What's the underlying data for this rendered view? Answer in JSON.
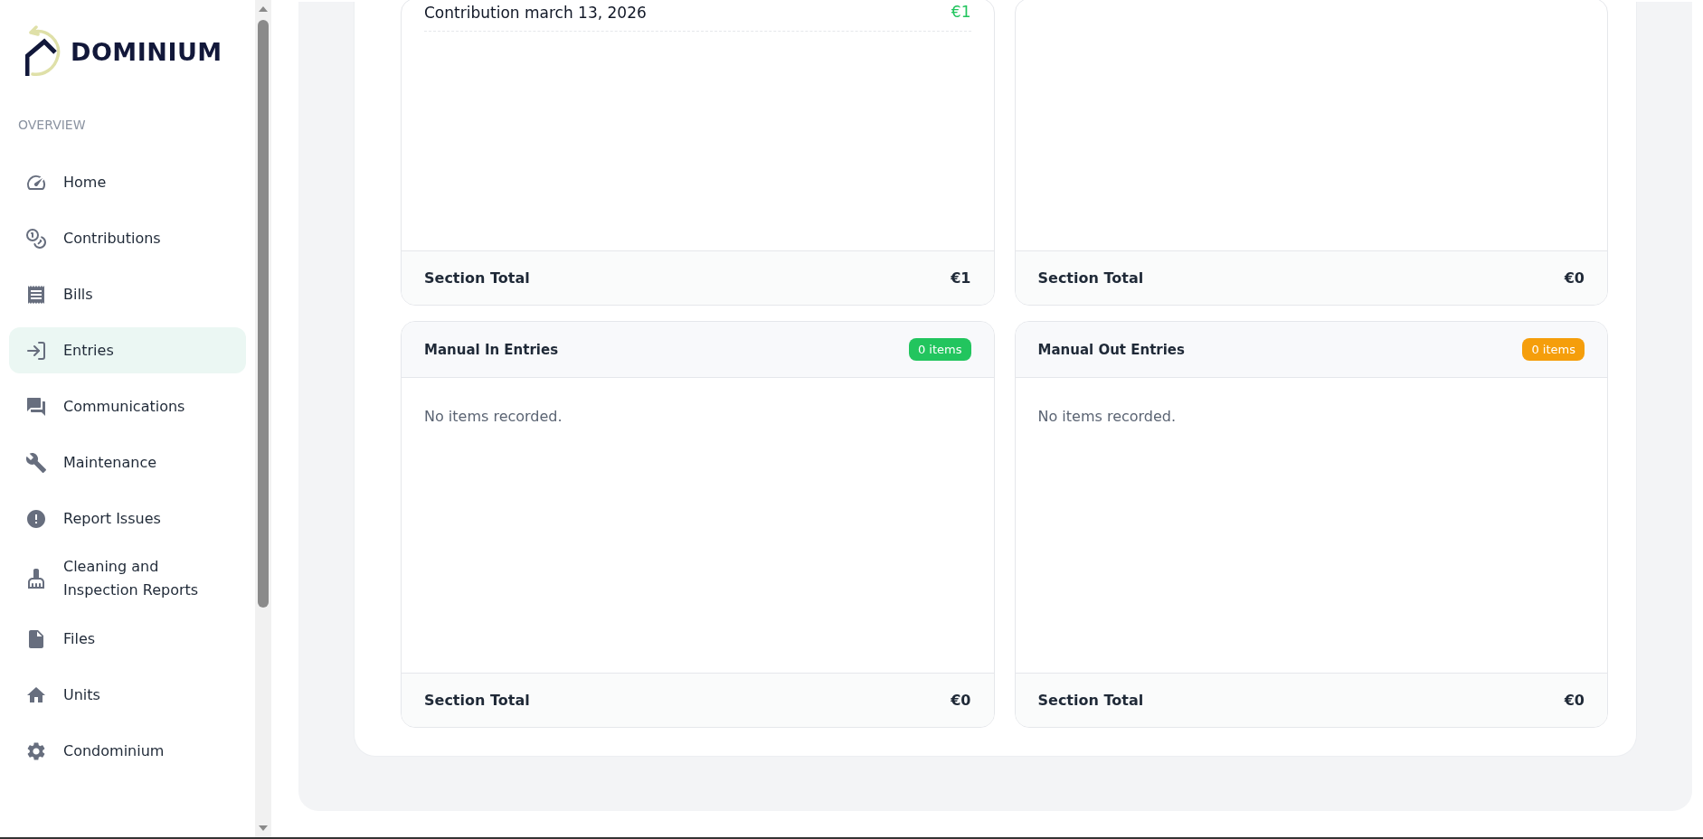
{
  "sidebar": {
    "logo": "DOMINIUM",
    "section": "OVERVIEW",
    "items": [
      {
        "label": "Home",
        "selected": false
      },
      {
        "label": "Contributions",
        "selected": false
      },
      {
        "label": "Bills",
        "selected": false
      },
      {
        "label": "Entries",
        "selected": true
      },
      {
        "label": "Communications",
        "selected": false
      },
      {
        "label": "Maintenance",
        "selected": false
      },
      {
        "label": "Report Issues",
        "selected": false
      },
      {
        "label": "Cleaning and Inspection Reports",
        "selected": false
      },
      {
        "label": "Files",
        "selected": false
      },
      {
        "label": "Units",
        "selected": false
      },
      {
        "label": "Condominium",
        "selected": false
      }
    ]
  },
  "sections": [
    {
      "items": [
        {
          "label": "Contribution march 13, 2026",
          "amount": "€1"
        }
      ],
      "total_label": "Section Total",
      "total": "€1"
    },
    {
      "total_label": "Section Total",
      "total": "€0"
    },
    {
      "title": "Manual In Entries",
      "badge": "0 items",
      "color": "#22c55e",
      "empty_text": "No items recorded.",
      "total_label": "Section Total",
      "total": "€0"
    },
    {
      "title": "Manual Out Entries",
      "badge": "0 items",
      "color": "#f59e0b",
      "empty_text": "No items recorded.",
      "total_label": "Section Total",
      "total": "€0"
    }
  ]
}
